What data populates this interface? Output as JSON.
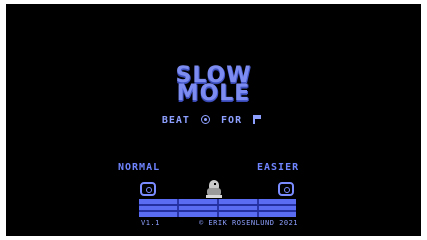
{
  "title": {
    "line1": "SLOW",
    "line2": "MOLE"
  },
  "objective": {
    "beat_label": "BEAT",
    "beat_icon": "clock-icon",
    "for_label": "FOR",
    "for_icon": "flag-icon"
  },
  "modes": {
    "left_label": "NORMAL",
    "right_label": "EASIER"
  },
  "footer": {
    "version": "V1.1",
    "copyright": "© ERIK ROSENLUND 2021"
  },
  "colors": {
    "background": "#000000",
    "title": "#7c8cf0",
    "text": "#8ea0ff",
    "ground": "#5a6cf2"
  }
}
